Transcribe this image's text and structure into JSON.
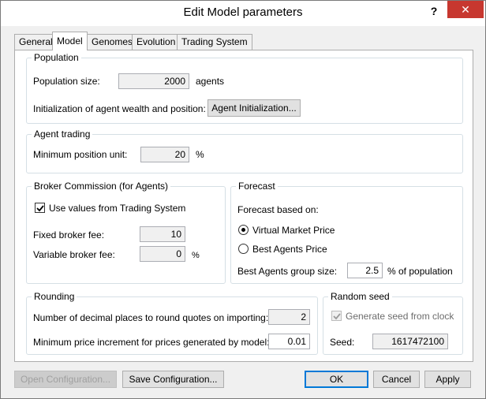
{
  "window": {
    "title": "Edit Model parameters",
    "help_label": "?",
    "close_label": "✕"
  },
  "tabs": [
    {
      "label": "General",
      "active": false
    },
    {
      "label": "Model",
      "active": true
    },
    {
      "label": "Genomes",
      "active": false
    },
    {
      "label": "Evolution",
      "active": false
    },
    {
      "label": "Trading System",
      "active": false
    }
  ],
  "population": {
    "group_title": "Population",
    "size_label": "Population size:",
    "size_value": "2000",
    "size_unit": "agents",
    "init_label": "Initialization of agent wealth and position:",
    "init_button": "Agent Initialization..."
  },
  "agent_trading": {
    "group_title": "Agent trading",
    "min_unit_label": "Minimum position unit:",
    "min_unit_value": "20",
    "min_unit_suffix": "%"
  },
  "broker": {
    "group_title": "Broker Commission (for Agents)",
    "use_values_label": "Use values from Trading System",
    "use_values_checked": true,
    "fixed_label": "Fixed broker fee:",
    "fixed_value": "10",
    "variable_label": "Variable broker fee:",
    "variable_value": "0",
    "variable_suffix": "%"
  },
  "forecast": {
    "group_title": "Forecast",
    "based_on_label": "Forecast based on:",
    "option_virtual": "Virtual Market Price",
    "option_best": "Best Agents Price",
    "selected": "Virtual Market Price",
    "group_size_label": "Best Agents group size:",
    "group_size_value": "2.5",
    "group_size_suffix": "% of population"
  },
  "rounding": {
    "group_title": "Rounding",
    "decimals_label": "Number of decimal places to round quotes on importing:",
    "decimals_value": "2",
    "increment_label": "Minimum price increment for prices generated by model:",
    "increment_value": "0.01"
  },
  "random_seed": {
    "group_title": "Random seed",
    "generate_label": "Generate seed from clock",
    "generate_checked": true,
    "seed_label": "Seed:",
    "seed_value": "1617472100"
  },
  "footer": {
    "open_config": "Open Configuration...",
    "save_config": "Save Configuration...",
    "ok": "OK",
    "cancel": "Cancel",
    "apply": "Apply"
  },
  "colors": {
    "close_button": "#c7372f",
    "default_button_border": "#0078d7",
    "group_border": "#d5dfe5"
  }
}
